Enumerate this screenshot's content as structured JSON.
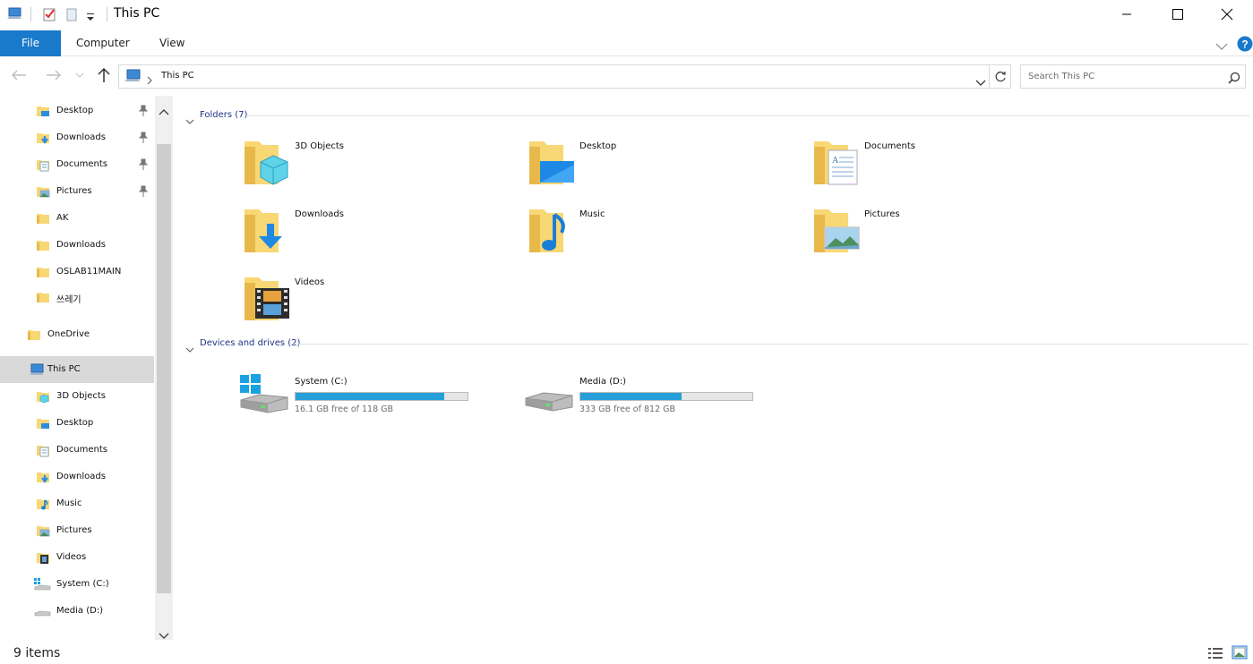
{
  "window": {
    "title": "This PC"
  },
  "ribbon": {
    "tabs": [
      "File",
      "Computer",
      "View"
    ]
  },
  "address": {
    "path": "This PC"
  },
  "search": {
    "placeholder": "Search This PC"
  },
  "nav": {
    "quick_access": [
      {
        "label": "Desktop",
        "pinned": true,
        "icon": "desktop-folder-icon"
      },
      {
        "label": "Downloads",
        "pinned": true,
        "icon": "downloads-folder-icon"
      },
      {
        "label": "Documents",
        "pinned": true,
        "icon": "documents-folder-icon"
      },
      {
        "label": "Pictures",
        "pinned": true,
        "icon": "pictures-folder-icon"
      },
      {
        "label": "AK",
        "pinned": false,
        "icon": "folder-icon"
      },
      {
        "label": "Downloads",
        "pinned": false,
        "icon": "folder-icon"
      },
      {
        "label": "OSLAB11MAIN",
        "pinned": false,
        "icon": "folder-icon"
      },
      {
        "label": "쓰레기",
        "pinned": false,
        "icon": "folder-icon"
      }
    ],
    "onedrive": "OneDrive",
    "this_pc": "This PC",
    "this_pc_children": [
      {
        "label": "3D Objects",
        "icon": "3d-objects-folder-icon"
      },
      {
        "label": "Desktop",
        "icon": "desktop-folder-icon"
      },
      {
        "label": "Documents",
        "icon": "documents-folder-icon"
      },
      {
        "label": "Downloads",
        "icon": "downloads-folder-icon"
      },
      {
        "label": "Music",
        "icon": "music-folder-icon"
      },
      {
        "label": "Pictures",
        "icon": "pictures-folder-icon"
      },
      {
        "label": "Videos",
        "icon": "videos-folder-icon"
      },
      {
        "label": "System (C:)",
        "icon": "system-drive-icon"
      },
      {
        "label": "Media (D:)",
        "icon": "drive-icon"
      }
    ]
  },
  "content": {
    "folders_header": "Folders (7)",
    "folders": [
      "3D Objects",
      "Desktop",
      "Documents",
      "Downloads",
      "Music",
      "Pictures",
      "Videos"
    ],
    "devices_header": "Devices and drives (2)",
    "drives": [
      {
        "name": "System (C:)",
        "free": "16.1 GB free of 118 GB",
        "used_fraction": 0.864
      },
      {
        "name": "Media (D:)",
        "free": "333 GB free of 812 GB",
        "used_fraction": 0.59
      }
    ]
  },
  "status": {
    "items": "9 items"
  },
  "colors": {
    "accent": "#1979ca",
    "drive_bar": "#26a0da",
    "folder": "#f8d775",
    "group_header": "#1e3287"
  }
}
